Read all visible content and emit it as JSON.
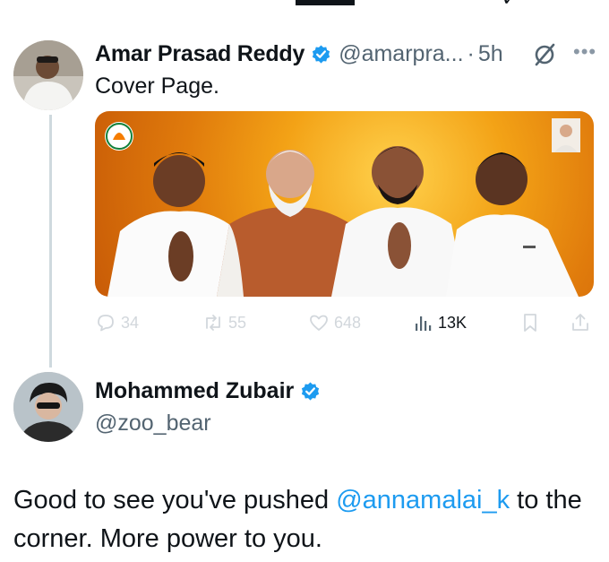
{
  "tweet1": {
    "display_name": "Amar Prasad Reddy",
    "handle": "@amarpra...",
    "separator": "·",
    "time": "5h",
    "text": "Cover Page.",
    "actions": {
      "replies": "34",
      "retweets": "55",
      "likes": "648",
      "views": "13K"
    }
  },
  "tweet2": {
    "display_name": "Mohammed Zubair",
    "handle": "@zoo_bear",
    "text_before": "Good to see you've pushed ",
    "mention": "@annamalai_k",
    "text_after": " to the corner. More power to you."
  },
  "colors": {
    "accent": "#1d9bf0",
    "muted": "#536471",
    "thread_line": "#cfd9de",
    "action_icon": "#d2d7dc"
  }
}
